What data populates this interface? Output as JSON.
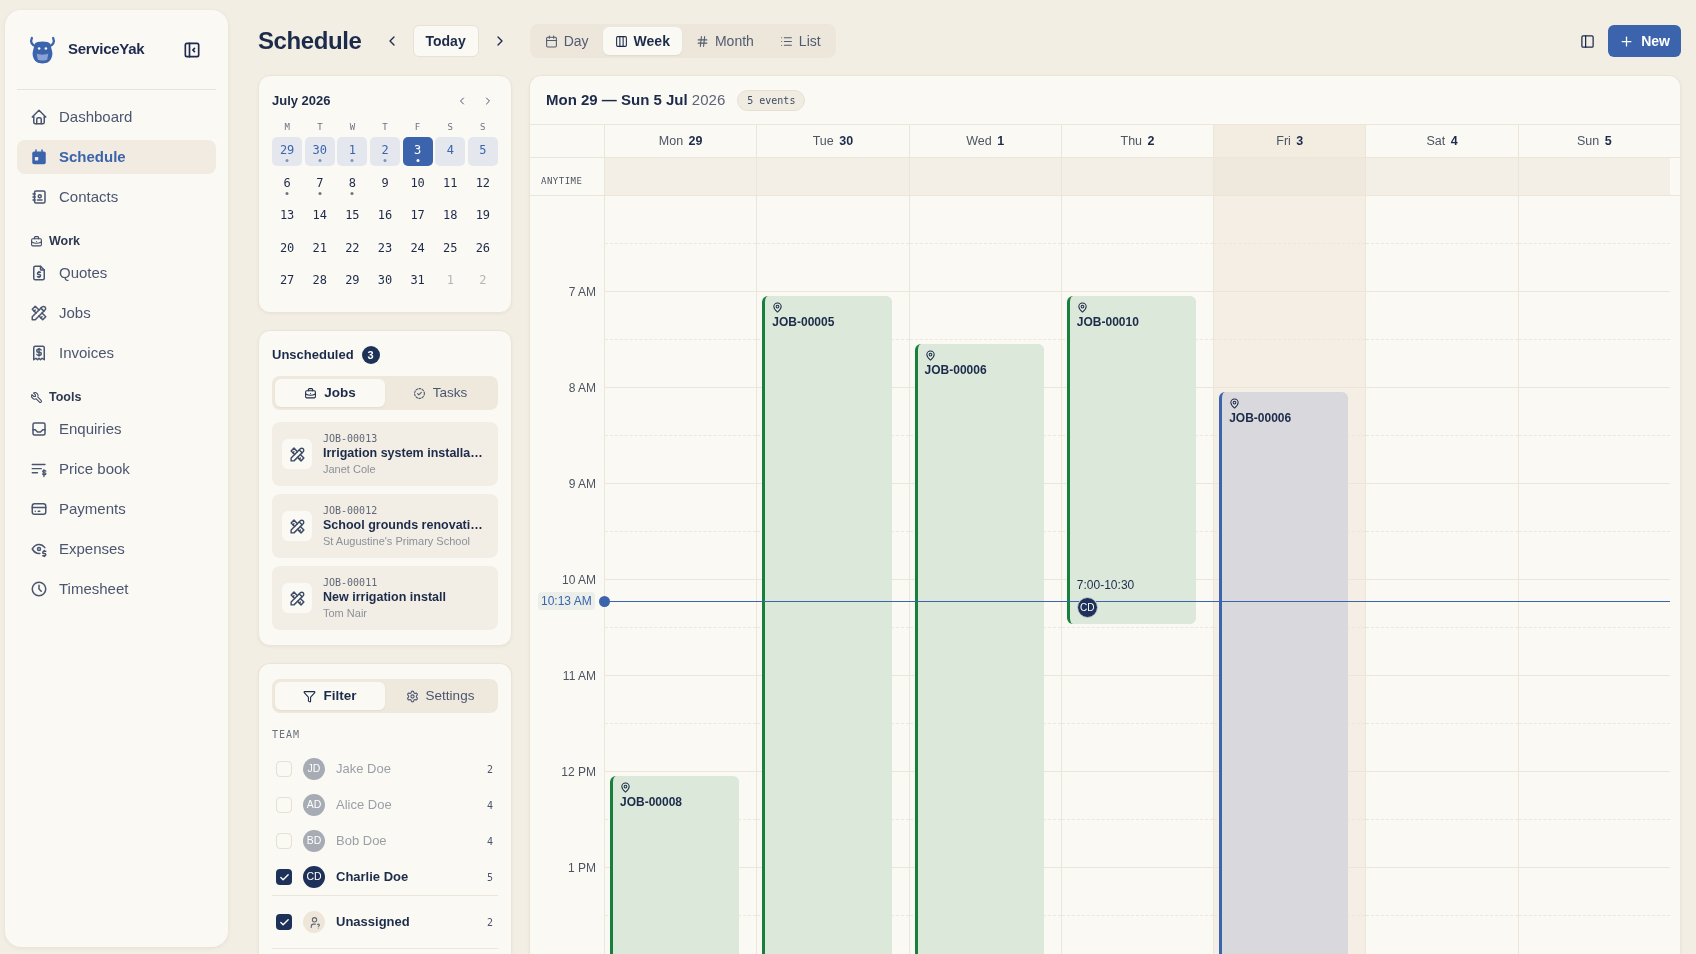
{
  "sidebar": {
    "brand": "ServiceYak",
    "groups": [
      {
        "items": [
          {
            "label": "Dashboard",
            "selected": false
          },
          {
            "label": "Schedule",
            "selected": true
          },
          {
            "label": "Contacts",
            "selected": false
          }
        ]
      },
      {
        "title": "Work",
        "items": [
          {
            "label": "Quotes",
            "selected": false
          },
          {
            "label": "Jobs",
            "selected": false
          },
          {
            "label": "Invoices",
            "selected": false
          }
        ]
      },
      {
        "title": "Tools",
        "items": [
          {
            "label": "Enquiries",
            "selected": false
          },
          {
            "label": "Price book",
            "selected": false
          },
          {
            "label": "Payments",
            "selected": false
          },
          {
            "label": "Expenses",
            "selected": false
          },
          {
            "label": "Timesheet",
            "selected": false
          }
        ]
      }
    ]
  },
  "header": {
    "title": "Schedule",
    "today_button": "Today",
    "views": [
      {
        "label": "Day",
        "selected": false
      },
      {
        "label": "Week",
        "selected": true
      },
      {
        "label": "Month",
        "selected": false
      },
      {
        "label": "List",
        "selected": false
      }
    ],
    "new_button": "New"
  },
  "mini_calendar": {
    "title": "July 2026",
    "weekdays": [
      "M",
      "T",
      "W",
      "T",
      "F",
      "S",
      "S"
    ],
    "weeks": [
      {
        "highlighted": true,
        "days": [
          {
            "day": "29",
            "selected": false,
            "outside": false,
            "dot": true
          },
          {
            "day": "30",
            "selected": false,
            "outside": false,
            "dot": true
          },
          {
            "day": "1",
            "selected": false,
            "outside": false,
            "dot": true
          },
          {
            "day": "2",
            "selected": false,
            "outside": false,
            "dot": true
          },
          {
            "day": "3",
            "selected": true,
            "outside": false,
            "dot": true
          },
          {
            "day": "4",
            "selected": false,
            "outside": false,
            "dot": false
          },
          {
            "day": "5",
            "selected": false,
            "outside": false,
            "dot": false
          }
        ]
      },
      {
        "highlighted": false,
        "days": [
          {
            "day": "6",
            "selected": false,
            "outside": false,
            "dot": true
          },
          {
            "day": "7",
            "selected": false,
            "outside": false,
            "dot": true
          },
          {
            "day": "8",
            "selected": false,
            "outside": false,
            "dot": true
          },
          {
            "day": "9",
            "selected": false,
            "outside": false,
            "dot": false
          },
          {
            "day": "10",
            "selected": false,
            "outside": false,
            "dot": false
          },
          {
            "day": "11",
            "selected": false,
            "outside": false,
            "dot": false
          },
          {
            "day": "12",
            "selected": false,
            "outside": false,
            "dot": false
          }
        ]
      },
      {
        "highlighted": false,
        "days": [
          {
            "day": "13",
            "selected": false,
            "outside": false,
            "dot": false
          },
          {
            "day": "14",
            "selected": false,
            "outside": false,
            "dot": false
          },
          {
            "day": "15",
            "selected": false,
            "outside": false,
            "dot": false
          },
          {
            "day": "16",
            "selected": false,
            "outside": false,
            "dot": false
          },
          {
            "day": "17",
            "selected": false,
            "outside": false,
            "dot": false
          },
          {
            "day": "18",
            "selected": false,
            "outside": false,
            "dot": false
          },
          {
            "day": "19",
            "selected": false,
            "outside": false,
            "dot": false
          }
        ]
      },
      {
        "highlighted": false,
        "days": [
          {
            "day": "20",
            "selected": false,
            "outside": false,
            "dot": false
          },
          {
            "day": "21",
            "selected": false,
            "outside": false,
            "dot": false
          },
          {
            "day": "22",
            "selected": false,
            "outside": false,
            "dot": false
          },
          {
            "day": "23",
            "selected": false,
            "outside": false,
            "dot": false
          },
          {
            "day": "24",
            "selected": false,
            "outside": false,
            "dot": false
          },
          {
            "day": "25",
            "selected": false,
            "outside": false,
            "dot": false
          },
          {
            "day": "26",
            "selected": false,
            "outside": false,
            "dot": false
          }
        ]
      },
      {
        "highlighted": false,
        "days": [
          {
            "day": "27",
            "selected": false,
            "outside": false,
            "dot": false
          },
          {
            "day": "28",
            "selected": false,
            "outside": false,
            "dot": false
          },
          {
            "day": "29",
            "selected": false,
            "outside": false,
            "dot": false
          },
          {
            "day": "30",
            "selected": false,
            "outside": false,
            "dot": false
          },
          {
            "day": "31",
            "selected": false,
            "outside": false,
            "dot": false
          },
          {
            "day": "1",
            "selected": false,
            "outside": true,
            "dot": false
          },
          {
            "day": "2",
            "selected": false,
            "outside": true,
            "dot": false
          }
        ]
      }
    ]
  },
  "unscheduled": {
    "title": "Unscheduled",
    "count": "3",
    "tabs": [
      {
        "label": "Jobs",
        "selected": true
      },
      {
        "label": "Tasks",
        "selected": false
      }
    ],
    "items": [
      {
        "id": "JOB-00013",
        "title": "Irrigation system installa…",
        "client": "Janet Cole"
      },
      {
        "id": "JOB-00012",
        "title": "School grounds renovati…",
        "client": "St Augustine's Primary School"
      },
      {
        "id": "JOB-00011",
        "title": "New irrigation install",
        "client": "Tom Nair"
      }
    ]
  },
  "filters": {
    "tabs": [
      {
        "label": "Filter",
        "selected": true
      },
      {
        "label": "Settings",
        "selected": false
      }
    ],
    "team_label": "TEAM",
    "members": [
      {
        "kind": "person",
        "initials": "JD",
        "name": "Jake Doe",
        "count": "2",
        "checked": false
      },
      {
        "kind": "person",
        "initials": "AD",
        "name": "Alice Doe",
        "count": "4",
        "checked": false
      },
      {
        "kind": "person",
        "initials": "BD",
        "name": "Bob Doe",
        "count": "4",
        "checked": false
      },
      {
        "kind": "person",
        "initials": "CD",
        "name": "Charlie Doe",
        "count": "5",
        "checked": true
      },
      {
        "kind": "unassigned",
        "name": "Unassigned",
        "count": "2",
        "checked": true
      }
    ]
  },
  "calendar": {
    "range": "**Mon 29 — Sun 5 Jul** 2026",
    "event_count": "5 events",
    "anytime_label": "ANYTIME",
    "hours": [
      "7 AM",
      "8 AM",
      "9 AM",
      "10 AM",
      "11 AM",
      "12 PM",
      "1 PM"
    ],
    "now_label": "10:13 AM",
    "days": [
      {
        "label": "Mon **29**",
        "today": false,
        "events": [
          {
            "title": "JOB-00008",
            "kind": "scheduled"
          }
        ]
      },
      {
        "label": "Tue **30**",
        "today": false,
        "events": [
          {
            "title": "JOB-00005",
            "kind": "scheduled"
          }
        ]
      },
      {
        "label": "Wed **1**",
        "today": false,
        "events": [
          {
            "title": "JOB-00006",
            "kind": "scheduled"
          }
        ]
      },
      {
        "label": "Thu **2**",
        "today": false,
        "events": [
          {
            "title": "JOB-00010",
            "time": "7:00-10:30",
            "assignee": "CD",
            "kind": "scheduled"
          }
        ]
      },
      {
        "label": "Fri **3**",
        "today": true,
        "events": [
          {
            "title": "JOB-00006",
            "kind": "pending"
          }
        ]
      },
      {
        "label": "Sat **4**",
        "today": false
      },
      {
        "label": "Sun **5**",
        "today": false
      }
    ]
  }
}
